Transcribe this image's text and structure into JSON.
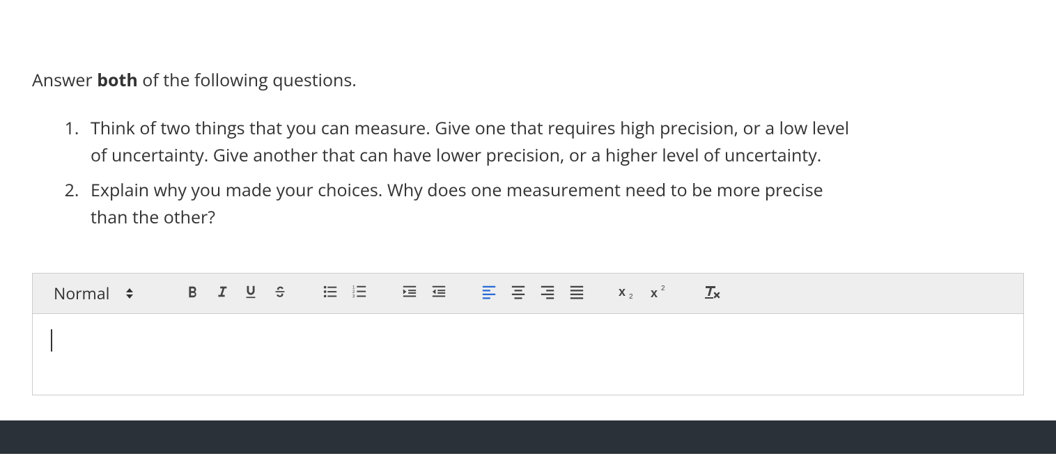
{
  "prompt": {
    "prefix": "Answer ",
    "bold": "both",
    "suffix": " of the following questions."
  },
  "questions": [
    "Think of two things that you can measure. Give one that requires high precision, or a low level of uncertainty. Give another that can have lower precision, or a higher level of uncertainty.",
    "Explain why you made your choices. Why does one measurement need to be more precise than the other?"
  ],
  "editor": {
    "format_picker": "Normal",
    "content": ""
  }
}
